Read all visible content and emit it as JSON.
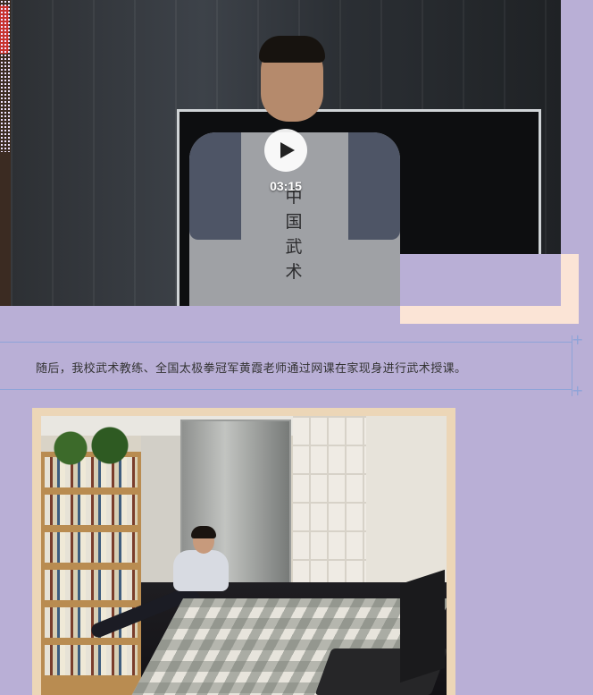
{
  "video": {
    "duration": "03:15",
    "play_icon": "play-icon",
    "shirt_text": "中国武术"
  },
  "caption": {
    "text": "随后，我校武术教练、全国太极拳冠军黄霞老师通过网课在家现身进行武术授课。"
  },
  "colors": {
    "background": "#b9afd6",
    "accent_peach": "#fbe4d6",
    "line_blue": "#8ea3d8",
    "photo_frame": "#ecd6b7"
  }
}
